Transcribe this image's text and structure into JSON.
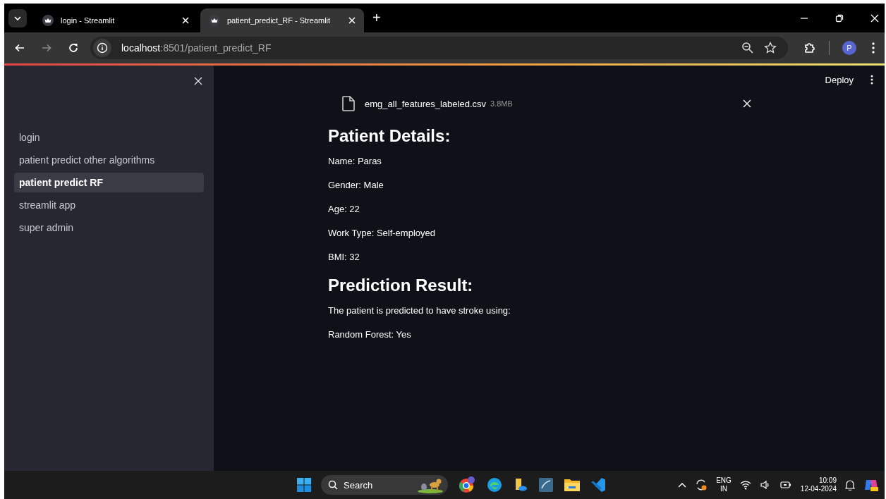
{
  "browser": {
    "tabs": [
      {
        "title": "login - Streamlit",
        "selected": false
      },
      {
        "title": "patient_predict_RF - Streamlit",
        "selected": true
      }
    ],
    "new_tab": "+",
    "address": {
      "host": "localhost",
      "path": ":8501/patient_predict_RF"
    },
    "profile": "P"
  },
  "app": {
    "deploy": "Deploy",
    "sidebar": {
      "items": [
        {
          "label": "login",
          "selected": false
        },
        {
          "label": "patient predict other algorithms",
          "selected": false
        },
        {
          "label": "patient predict RF",
          "selected": true
        },
        {
          "label": "streamlit app",
          "selected": false
        },
        {
          "label": "super admin",
          "selected": false
        }
      ]
    },
    "upload": {
      "file_name": "emg_all_features_labeled.csv",
      "size": "3.8MB"
    },
    "sections": [
      {
        "heading": "Patient Details:",
        "lines": [
          "Name: Paras",
          "Gender: Male",
          "Age: 22",
          "Work Type: Self-employed",
          "BMI: 32"
        ]
      },
      {
        "heading": "Prediction Result:",
        "lines": [
          "The patient is predicted to have stroke using:",
          "Random Forest: Yes"
        ]
      }
    ]
  },
  "taskbar": {
    "search": "Search",
    "language": [
      "ENG",
      "IN"
    ],
    "time": "10:09",
    "date": "12-04-2024"
  }
}
